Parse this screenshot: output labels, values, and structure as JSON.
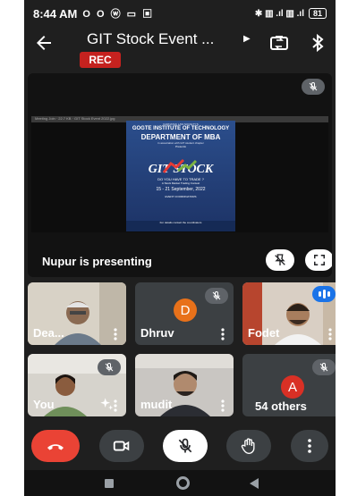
{
  "status_bar": {
    "time": "8:44 AM",
    "left_icons": "O O ⓦ ▭ ▣",
    "right_icons": "✱ ▥ .ıl ▥ .ıl",
    "battery": "81"
  },
  "meeting": {
    "title": "GIT Stock Event ...",
    "recording_badge": "REC"
  },
  "presentation": {
    "label": "Nupur is presenting",
    "window_caption": "Meeting Join · 22.7 KB · GIT Stock Event 2022.jpg",
    "poster": {
      "society": "KARNATAK LAW SOCIETY'S",
      "institute": "GOGTE INSTITUTE OF TECHNOLOGY",
      "dept": "DEPARTMENT OF MBA",
      "collab": "in association with GIT student chapter",
      "presents": "Presents",
      "event": "GIT STOCK",
      "tagline": "DO YOU HAVE TO TRADE ?",
      "subtitle": "A Stock Market Trading Contest",
      "dates": "15 - 21 September, 2022",
      "contact": "EVENT COORDINATORS",
      "footer": "For details contact the coordinators"
    }
  },
  "participants": [
    {
      "name": "Dea...",
      "muted": false
    },
    {
      "name": "Dhruv",
      "initial": "D",
      "avatar_color": "#e8711a",
      "muted": true
    },
    {
      "name": "Fodet",
      "muted": false,
      "speaking": true
    },
    {
      "name": "You",
      "muted": true
    },
    {
      "name": "mudit",
      "muted": false
    },
    {
      "name": "54 others",
      "initial": "A",
      "avatar_color": "#d93025",
      "muted": true
    }
  ],
  "controls": [
    "end-call",
    "camera",
    "microphone",
    "raise-hand",
    "more-options"
  ],
  "colors": {
    "background": "#1f1f1f",
    "end_call": "#ea4335",
    "rec": "#c5221f",
    "speaking": "#1a73e8"
  }
}
